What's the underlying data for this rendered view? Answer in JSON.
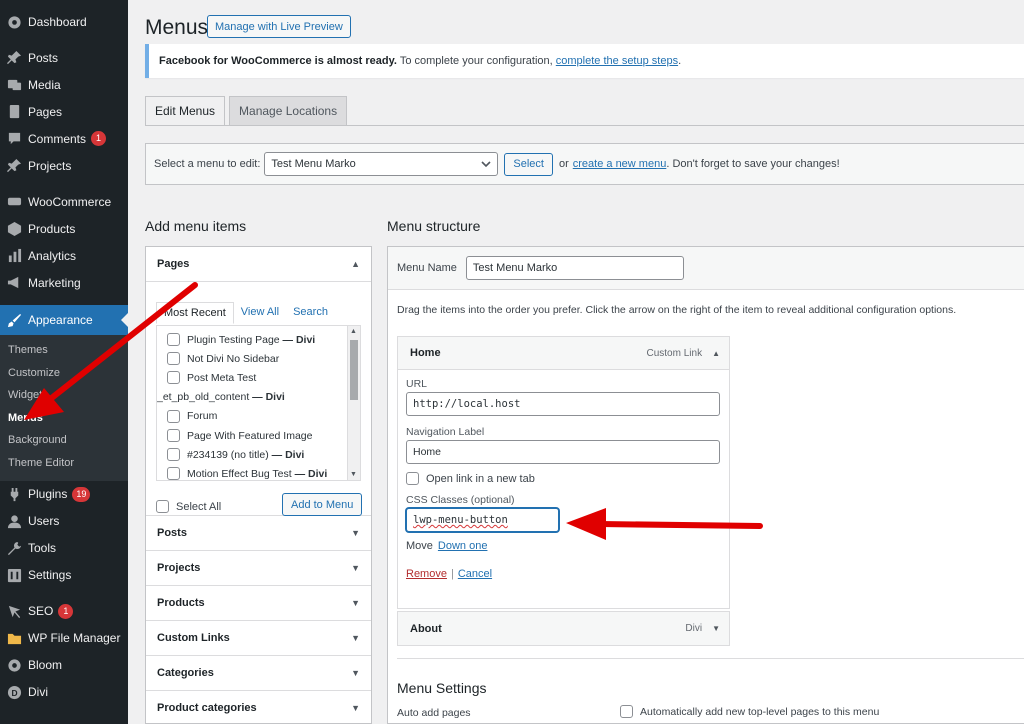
{
  "sidebar": {
    "items": [
      {
        "label": "Dashboard",
        "icon": "dashboard-icon"
      },
      {
        "label": "Posts",
        "icon": "pin-icon"
      },
      {
        "label": "Media",
        "icon": "media-icon"
      },
      {
        "label": "Pages",
        "icon": "page-icon"
      },
      {
        "label": "Comments",
        "icon": "comment-icon",
        "badge": "1"
      },
      {
        "label": "Projects",
        "icon": "pin-icon"
      },
      {
        "label": "WooCommerce",
        "icon": "woo-icon"
      },
      {
        "label": "Products",
        "icon": "box-icon"
      },
      {
        "label": "Analytics",
        "icon": "bars-icon"
      },
      {
        "label": "Marketing",
        "icon": "megaphone-icon"
      },
      {
        "label": "Appearance",
        "icon": "brush-icon"
      },
      {
        "label": "Plugins",
        "icon": "plug-icon",
        "badge": "19"
      },
      {
        "label": "Users",
        "icon": "user-icon"
      },
      {
        "label": "Tools",
        "icon": "wrench-icon"
      },
      {
        "label": "Settings",
        "icon": "sliders-icon"
      },
      {
        "label": "SEO",
        "icon": "seo-icon",
        "badge": "1"
      },
      {
        "label": "WP File Manager",
        "icon": "folder-icon"
      },
      {
        "label": "Bloom",
        "icon": "bloom-icon"
      },
      {
        "label": "Divi",
        "icon": "divi-icon"
      }
    ],
    "submenu": [
      "Themes",
      "Customize",
      "Widgets",
      "Menus",
      "Background",
      "Theme Editor"
    ]
  },
  "header": {
    "title": "Menus",
    "preview_btn": "Manage with Live Preview"
  },
  "notice": {
    "bold": "Facebook for WooCommerce is almost ready.",
    "text": " To complete your configuration, ",
    "link": "complete the setup steps",
    "end": "."
  },
  "tabs": [
    "Edit Menus",
    "Manage Locations"
  ],
  "select_bar": {
    "label": "Select a menu to edit:",
    "selected": "Test Menu Marko",
    "button": "Select",
    "or": "or",
    "create_link": "create a new menu",
    "tail": ". Don't forget to save your changes!"
  },
  "add_items": {
    "heading": "Add menu items",
    "pages_title": "Pages",
    "inner_tabs": [
      "Most Recent",
      "View All",
      "Search"
    ],
    "pages": [
      {
        "name": "Plugin Testing Page",
        "suffix": " — Divi",
        "check": true
      },
      {
        "name": "Not Divi No Sidebar",
        "suffix": "",
        "check": true
      },
      {
        "name": "Post Meta Test",
        "suffix": "",
        "check": true
      },
      {
        "name": "_et_pb_old_content",
        "suffix": " — Divi",
        "check": false
      },
      {
        "name": "Forum",
        "suffix": "",
        "check": true
      },
      {
        "name": "Page With Featured Image",
        "suffix": "",
        "check": true
      },
      {
        "name": "#234139 (no title)",
        "suffix": " — Divi",
        "check": true
      },
      {
        "name": "Motion Effect Bug Test",
        "suffix": " — Divi",
        "check": true
      }
    ],
    "select_all": "Select All",
    "add_button": "Add to Menu",
    "sections": [
      "Posts",
      "Projects",
      "Products",
      "Custom Links",
      "Categories",
      "Product categories"
    ]
  },
  "structure": {
    "heading": "Menu structure",
    "menu_name_label": "Menu Name",
    "menu_name_value": "Test Menu Marko",
    "hint": "Drag the items into the order you prefer. Click the arrow on the right of the item to reveal additional configuration options.",
    "home": {
      "title": "Home",
      "kind": "Custom Link",
      "url_label": "URL",
      "url_value": "http://local.host",
      "nav_label": "Navigation Label",
      "nav_value": "Home",
      "new_tab": "Open link in a new tab",
      "css_label": "CSS Classes (optional)",
      "css_value": "lwp-menu-button",
      "move": "Move",
      "down_one": "Down one",
      "remove": "Remove",
      "pipe": "|",
      "cancel": "Cancel"
    },
    "about": {
      "title": "About",
      "kind": "Divi"
    },
    "settings_title": "Menu Settings",
    "auto_add_label": "Auto add pages",
    "auto_add_text": "Automatically add new top-level pages to this menu"
  },
  "colors": {
    "sidebar_bg": "#1d2327",
    "active": "#2271b1",
    "annotation": "#e00000",
    "badge": "#d63638"
  }
}
